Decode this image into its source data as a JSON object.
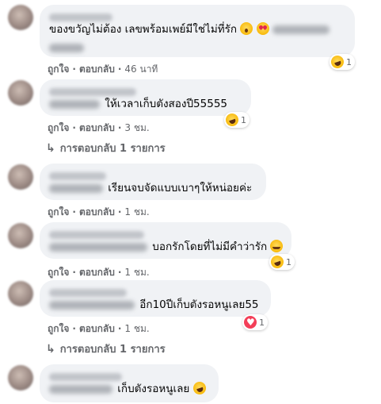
{
  "action_labels": {
    "like": "ถูกใจ",
    "reply": "ตอบกลับ",
    "separator": "·"
  },
  "comments": [
    {
      "text": "ของขวัญไม่ต้อง เลขพร้อมเพย์มีใช่ไม่ที่รัก",
      "time": "46 นาที",
      "reaction": {
        "type": "haha",
        "count": "1"
      }
    },
    {
      "text": "ให้เวลาเก็บตังสองปี55555",
      "time": "3 ชม.",
      "reaction": {
        "type": "haha",
        "count": "1"
      },
      "replies_label": "การตอบกลับ 1 รายการ"
    },
    {
      "text": "เรียนจบจัดแบบเบาๆให้หน่อยค่ะ",
      "time": "1 ชม."
    },
    {
      "text": "บอกรักโดยที่ไม่มีคำว่ารัก",
      "time": "1 ชม.",
      "reaction": {
        "type": "haha",
        "count": "1"
      }
    },
    {
      "text": "อีก10ปีเก็บตังรอหนูเลย55",
      "time": "1 ชม.",
      "reaction": {
        "type": "love",
        "count": "1"
      },
      "replies_label": "การตอบกลับ 1 รายการ"
    },
    {
      "text": "เก็บตังรอหนูเลย"
    }
  ],
  "colors": {
    "bubble": "#f0f2f5",
    "meta": "#65676b",
    "love": "#f33e58",
    "emoji": "#f7b500"
  },
  "icons": [
    "reply-arrow-icon",
    "haha-reaction-icon",
    "love-reaction-icon"
  ]
}
